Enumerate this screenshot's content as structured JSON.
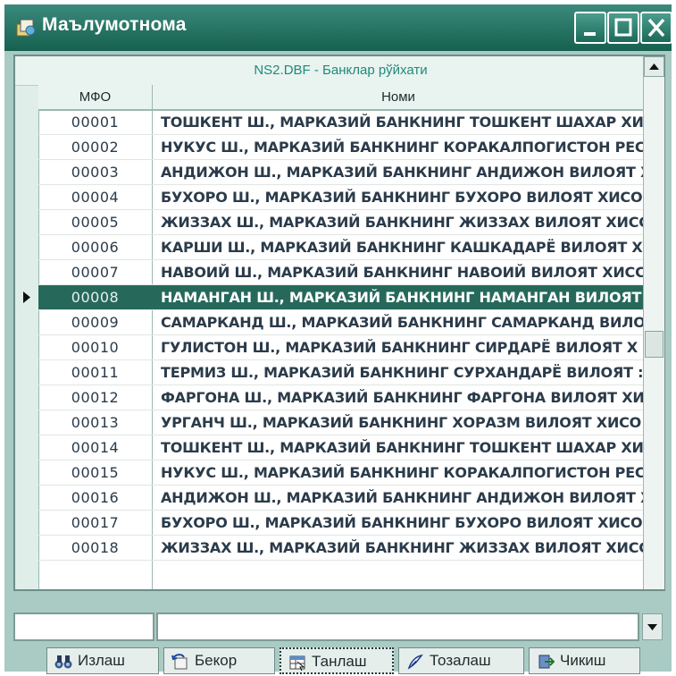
{
  "window": {
    "title": "Маълумотнома",
    "icon": "app-icon",
    "controls": [
      "minimize-icon",
      "maximize-icon",
      "close-icon"
    ]
  },
  "grid": {
    "caption": "NS2.DBF - Банклар рўйхати",
    "columns": [
      "МФО",
      "Номи"
    ],
    "selected_index": 7,
    "rows": [
      {
        "mfo": "00001",
        "name": "ТОШКЕНТ Ш., МАРКАЗИЙ БАНКНИНГ ТОШКЕНТ ШАХАР ХИС"
      },
      {
        "mfo": "00002",
        "name": "НУКУС Ш., МАРКАЗИЙ БАНКНИНГ КОРАКАЛПОГИСТОН РЕС"
      },
      {
        "mfo": "00003",
        "name": "АНДИЖОН Ш., МАРКАЗИЙ БАНКНИНГ АНДИЖОН ВИЛОЯТ Х"
      },
      {
        "mfo": "00004",
        "name": "БУХОРО Ш., МАРКАЗИЙ БАНКНИНГ БУХОРО ВИЛОЯТ ХИСО"
      },
      {
        "mfo": "00005",
        "name": "ЖИЗЗАХ Ш., МАРКАЗИЙ БАНКНИНГ ЖИЗЗАХ ВИЛОЯТ ХИСС"
      },
      {
        "mfo": "00006",
        "name": "КАРШИ Ш., МАРКАЗИЙ БАНКНИНГ КАШКАДАРЁ ВИЛОЯТ ХИ"
      },
      {
        "mfo": "00007",
        "name": "НАВОИЙ Ш., МАРКАЗИЙ БАНКНИНГ НАВОИЙ ВИЛОЯТ ХИСС"
      },
      {
        "mfo": "00008",
        "name": "НАМАНГАН Ш., МАРКАЗИЙ БАНКНИНГ НАМАНГАН ВИЛОЯТ"
      },
      {
        "mfo": "00009",
        "name": "САМАРКАНД Ш., МАРКАЗИЙ БАНКНИНГ САМАРКАНД ВИЛО:"
      },
      {
        "mfo": "00010",
        "name": "ГУЛИСТОН Ш., МАРКАЗИЙ БАНКНИНГ СИРДАРЁ ВИЛОЯТ Х"
      },
      {
        "mfo": "00011",
        "name": "ТЕРМИЗ Ш., МАРКАЗИЙ БАНКНИНГ СУРХАНДАРЁ ВИЛОЯТ :"
      },
      {
        "mfo": "00012",
        "name": "ФАРГОНА Ш., МАРКАЗИЙ БАНКНИНГ ФАРГОНА ВИЛОЯТ ХИ"
      },
      {
        "mfo": "00013",
        "name": "УРГАНЧ Ш., МАРКАЗИЙ БАНКНИНГ ХОРАЗМ ВИЛОЯТ ХИСО"
      },
      {
        "mfo": "00014",
        "name": "ТОШКЕНТ Ш., МАРКАЗИЙ БАНКНИНГ ТОШКЕНТ ШАХАР ХИС"
      },
      {
        "mfo": "00015",
        "name": "НУКУС Ш., МАРКАЗИЙ БАНКНИНГ КОРАКАЛПОГИСТОН РЕС"
      },
      {
        "mfo": "00016",
        "name": "АНДИЖОН Ш., МАРКАЗИЙ БАНКНИНГ АНДИЖОН ВИЛОЯТ Х"
      },
      {
        "mfo": "00017",
        "name": "БУХОРО Ш., МАРКАЗИЙ БАНКНИНГ БУХОРО ВИЛОЯТ ХИСО"
      },
      {
        "mfo": "00018",
        "name": "ЖИЗЗАХ Ш., МАРКАЗИЙ БАНКНИНГ ЖИЗЗАХ ВИЛОЯТ ХИСС"
      }
    ]
  },
  "footer": {
    "mfo_value": "",
    "name_value": ""
  },
  "buttons": [
    {
      "name": "search-button",
      "label": "Излаш",
      "icon": "binoculars-icon"
    },
    {
      "name": "cancel-button",
      "label": "Бекор",
      "icon": "undo-icon"
    },
    {
      "name": "select-button",
      "label": "Танлаш",
      "icon": "table-select-icon",
      "focused": true
    },
    {
      "name": "clear-button",
      "label": "Тозалаш",
      "icon": "eraser-icon"
    },
    {
      "name": "exit-button",
      "label": "Чикиш",
      "icon": "exit-icon"
    }
  ],
  "colors": {
    "title_bar": "#1c6a59",
    "window_bg": "#a9cbc4",
    "selection": "#26695b",
    "caption_text": "#1f8a79"
  }
}
